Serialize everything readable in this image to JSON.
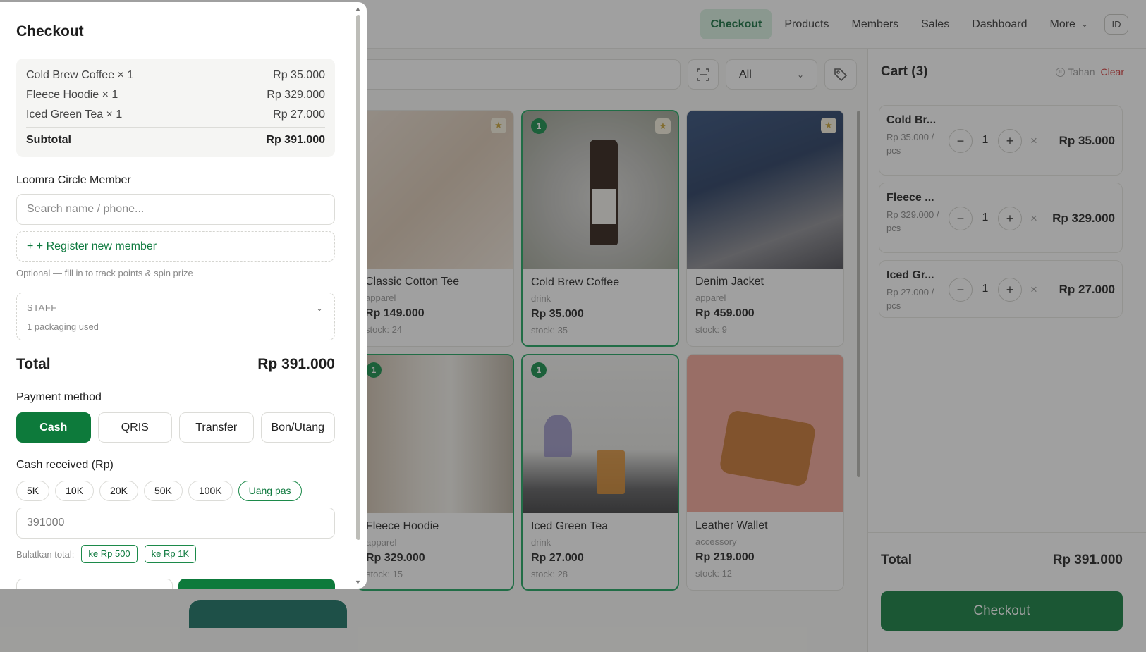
{
  "nav": {
    "items": [
      "Checkout",
      "Products",
      "Members",
      "Sales",
      "Dashboard"
    ],
    "more": "More",
    "lang": "ID"
  },
  "filters": {
    "category": "All"
  },
  "products": [
    {
      "name": "Classic Cotton Tee",
      "category": "apparel",
      "price": "Rp 149.000",
      "stock": "stock: 24",
      "favorite": true,
      "in_cart": ""
    },
    {
      "name": "Cold Brew Coffee",
      "category": "drink",
      "price": "Rp 35.000",
      "stock": "stock: 35",
      "favorite": true,
      "in_cart": "1"
    },
    {
      "name": "Denim Jacket",
      "category": "apparel",
      "price": "Rp 459.000",
      "stock": "stock: 9",
      "favorite": true,
      "in_cart": ""
    },
    {
      "name": "Fleece Hoodie",
      "category": "apparel",
      "price": "Rp 329.000",
      "stock": "stock: 15",
      "favorite": false,
      "in_cart": "1"
    },
    {
      "name": "Iced Green Tea",
      "category": "drink",
      "price": "Rp 27.000",
      "stock": "stock: 28",
      "favorite": false,
      "in_cart": "1"
    },
    {
      "name": "Leather Wallet",
      "category": "accessory",
      "price": "Rp 219.000",
      "stock": "stock: 12",
      "favorite": false,
      "in_cart": ""
    }
  ],
  "cart": {
    "title": "Cart (3)",
    "hold": "Tahan",
    "clear": "Clear",
    "items": [
      {
        "name": "Cold Br...",
        "unit": "Rp 35.000 / pcs",
        "qty": "1",
        "total": "Rp 35.000"
      },
      {
        "name": "Fleece ...",
        "unit": "Rp 329.000 / pcs",
        "qty": "1",
        "total": "Rp 329.000"
      },
      {
        "name": "Iced Gr...",
        "unit": "Rp 27.000 / pcs",
        "qty": "1",
        "total": "Rp 27.000"
      }
    ],
    "total_label": "Total",
    "total": "Rp 391.000",
    "checkout": "Checkout"
  },
  "modal": {
    "title": "Checkout",
    "lines": [
      {
        "label": "Cold Brew Coffee × 1",
        "amount": "Rp 35.000"
      },
      {
        "label": "Fleece Hoodie × 1",
        "amount": "Rp 329.000"
      },
      {
        "label": "Iced Green Tea × 1",
        "amount": "Rp 27.000"
      }
    ],
    "subtotal_label": "Subtotal",
    "subtotal": "Rp 391.000",
    "member_label": "Loomra Circle Member",
    "member_placeholder": "Search name / phone...",
    "register": "+ + Register new member",
    "member_hint": "Optional — fill in to track points & spin prize",
    "staff_title": "STAFF",
    "staff_sub": "1 packaging used",
    "total_label": "Total",
    "total": "Rp 391.000",
    "payment_label": "Payment method",
    "payment_methods": [
      "Cash",
      "QRIS",
      "Transfer",
      "Bon/Utang"
    ],
    "cash_label": "Cash received (Rp)",
    "cash_chips": [
      "5K",
      "10K",
      "20K",
      "50K",
      "100K",
      "Uang pas"
    ],
    "cash_value": "391000",
    "round_label": "Bulatkan total:",
    "round_chips": [
      "ke Rp 500",
      "ke Rp 1K"
    ]
  },
  "colors": {
    "accent": "#0d7a3b",
    "accent_light": "#d8f0e0",
    "danger": "#d43a3a"
  }
}
